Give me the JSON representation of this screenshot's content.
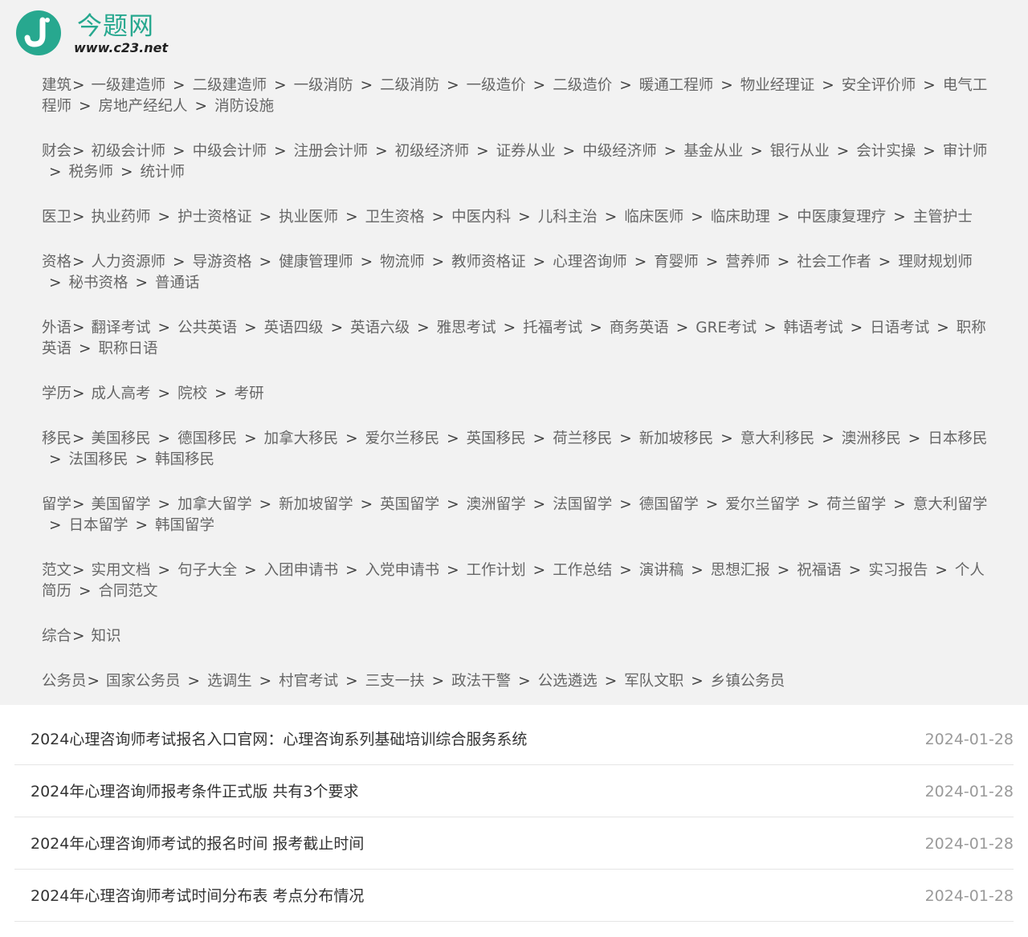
{
  "header": {
    "logo_icon": "j-letter-logo-icon",
    "brand_name": "今题网",
    "brand_url": "www.c23.net",
    "brand_color": "#27a88f"
  },
  "categories": [
    {
      "head": "建筑",
      "items": [
        "一级建造师",
        "二级建造师",
        "一级消防",
        "二级消防",
        "一级造价",
        "二级造价",
        "暖通工程师",
        "物业经理证",
        "安全评价师",
        "电气工程师",
        "房地产经纪人",
        "消防设施"
      ]
    },
    {
      "head": "财会",
      "items": [
        "初级会计师",
        "中级会计师",
        "注册会计师",
        "初级经济师",
        "证券从业",
        "中级经济师",
        "基金从业",
        "银行从业",
        "会计实操",
        "审计师",
        "税务师",
        "统计师"
      ]
    },
    {
      "head": "医卫",
      "items": [
        "执业药师",
        "护士资格证",
        "执业医师",
        "卫生资格",
        "中医内科",
        "儿科主治",
        "临床医师",
        "临床助理",
        "中医康复理疗",
        "主管护士"
      ]
    },
    {
      "head": "资格",
      "items": [
        "人力资源师",
        "导游资格",
        "健康管理师",
        "物流师",
        "教师资格证",
        "心理咨询师",
        "育婴师",
        "营养师",
        "社会工作者",
        "理财规划师",
        "秘书资格",
        "普通话"
      ]
    },
    {
      "head": "外语",
      "items": [
        "翻译考试",
        "公共英语",
        "英语四级",
        "英语六级",
        "雅思考试",
        "托福考试",
        "商务英语",
        "GRE考试",
        "韩语考试",
        "日语考试",
        "职称英语",
        "职称日语"
      ]
    },
    {
      "head": "学历",
      "items": [
        "成人高考",
        "院校",
        "考研"
      ]
    },
    {
      "head": "移民",
      "items": [
        "美国移民",
        "德国移民",
        "加拿大移民",
        "爱尔兰移民",
        "英国移民",
        "荷兰移民",
        "新加坡移民",
        "意大利移民",
        "澳洲移民",
        "日本移民",
        "法国移民",
        "韩国移民"
      ]
    },
    {
      "head": "留学",
      "items": [
        "美国留学",
        "加拿大留学",
        "新加坡留学",
        "英国留学",
        "澳洲留学",
        "法国留学",
        "德国留学",
        "爱尔兰留学",
        "荷兰留学",
        "意大利留学",
        "日本留学",
        "韩国留学"
      ]
    },
    {
      "head": "范文",
      "items": [
        "实用文档",
        "句子大全",
        "入团申请书",
        "入党申请书",
        "工作计划",
        "工作总结",
        "演讲稿",
        "思想汇报",
        "祝福语",
        "实习报告",
        "个人简历",
        "合同范文"
      ]
    },
    {
      "head": "综合",
      "items": [
        "知识"
      ]
    },
    {
      "head": "公务员",
      "items": [
        "国家公务员",
        "选调生",
        "村官考试",
        "三支一扶",
        "政法干警",
        "公选遴选",
        "军队文职",
        "乡镇公务员"
      ]
    }
  ],
  "separator": ">",
  "articles": [
    {
      "title": "2024心理咨询师考试报名入口官网：心理咨询系列基础培训综合服务系统",
      "date": "2024-01-28"
    },
    {
      "title": "2024年心理咨询师报考条件正式版 共有3个要求",
      "date": "2024-01-28"
    },
    {
      "title": "2024年心理咨询师考试的报名时间 报考截止时间",
      "date": "2024-01-28"
    },
    {
      "title": "2024年心理咨询师考试时间分布表 考点分布情况",
      "date": "2024-01-28"
    }
  ]
}
